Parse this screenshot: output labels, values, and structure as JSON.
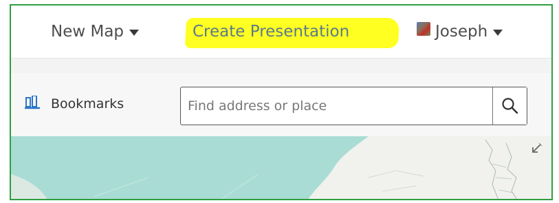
{
  "nav": {
    "new_map_label": "New Map",
    "create_presentation_label": "Create Presentation",
    "user_name": "Joseph"
  },
  "toolbar": {
    "bookmarks_label": "Bookmarks"
  },
  "search": {
    "placeholder": "Find address or place",
    "value": ""
  },
  "colors": {
    "frame_border": "#2e9e3f",
    "highlight": "#ffff22",
    "water": "#a9dcd4",
    "land": "#f1f1ee",
    "bookmark_icon": "#2a76c7"
  },
  "icons": {
    "bookmarks": "bookmarks-icon",
    "search": "search-icon",
    "expand": "expand-map-icon",
    "user_menu": "chevron-down-icon"
  }
}
